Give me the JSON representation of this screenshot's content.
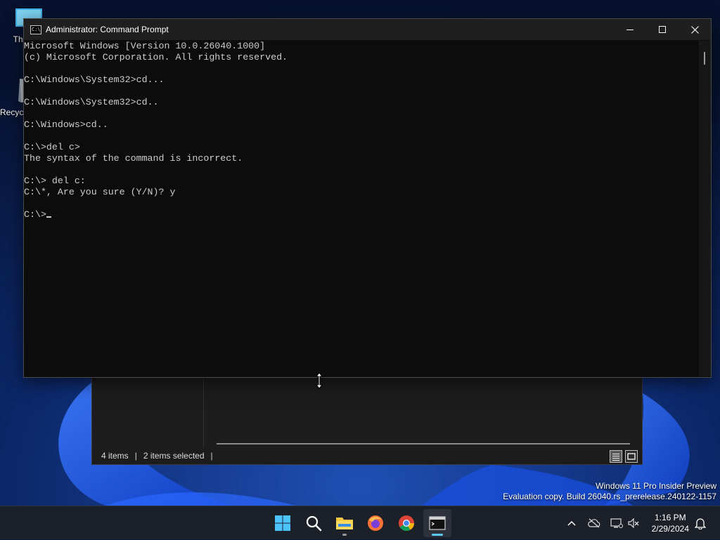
{
  "desktop": {
    "icons": [
      {
        "label": "This PC",
        "icon": "computer-icon"
      },
      {
        "label": "Recycle Bin",
        "icon": "recycle-bin-icon"
      }
    ]
  },
  "explorer": {
    "status_items": "4 items",
    "status_selected": "2 items selected",
    "view_buttons": [
      "details-view-icon",
      "large-icons-view-icon"
    ]
  },
  "cmd": {
    "title": "Administrator: Command Prompt",
    "controls": {
      "minimize": "minimize-icon",
      "maximize": "maximize-icon",
      "close": "close-icon"
    },
    "lines": [
      "Microsoft Windows [Version 10.0.26040.1000]",
      "(c) Microsoft Corporation. All rights reserved.",
      "",
      "C:\\Windows\\System32>cd...",
      "",
      "C:\\Windows\\System32>cd..",
      "",
      "C:\\Windows>cd..",
      "",
      "C:\\>del c>",
      "The syntax of the command is incorrect.",
      "",
      "C:\\> del c:",
      "C:\\*, Are you sure (Y/N)? y",
      ""
    ],
    "prompt": "C:\\>"
  },
  "watermark": {
    "line1": "Windows 11 Pro Insider Preview",
    "line2": "Evaluation copy. Build 26040.rs_prerelease.240122-1157"
  },
  "taskbar": {
    "apps": [
      {
        "name": "start-button",
        "icon": "windows-logo-icon"
      },
      {
        "name": "search-button",
        "icon": "search-icon"
      },
      {
        "name": "file-explorer-button",
        "icon": "folder-icon"
      },
      {
        "name": "firefox-button",
        "icon": "firefox-icon"
      },
      {
        "name": "chrome-button",
        "icon": "chrome-icon"
      },
      {
        "name": "terminal-button",
        "icon": "terminal-icon"
      }
    ],
    "tray": [
      "chevron-up-icon",
      "cloud-offline-icon",
      "network-icon",
      "volume-muted-icon"
    ],
    "time": "1:16 PM",
    "date": "2/29/2024",
    "notification_icon": "bell-icon"
  },
  "colors": {
    "console_bg": "#0c0c0c",
    "console_fg": "#cccccc",
    "titlebar": "#1f1f1f",
    "taskbar": "#1c2029",
    "accent": "#5cc8ff"
  }
}
